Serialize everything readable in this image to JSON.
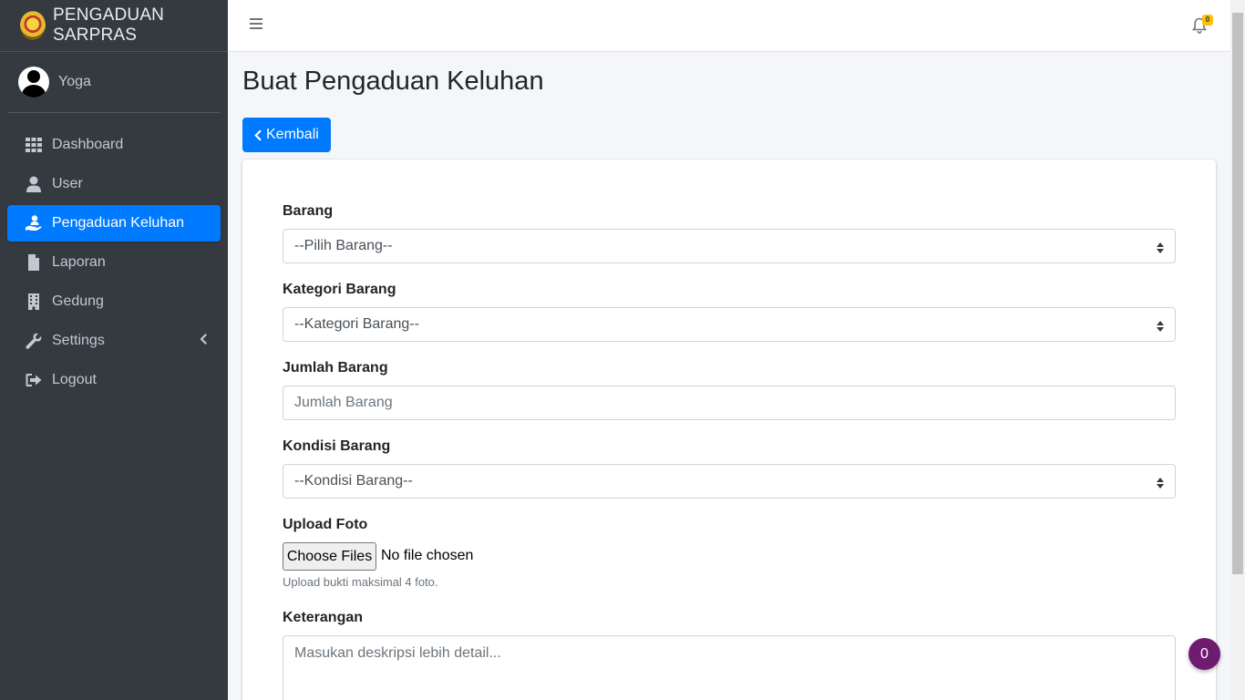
{
  "brand": {
    "title": "PENGADUAN SARPRAS"
  },
  "user": {
    "name": "Yoga"
  },
  "sidebar": {
    "items": [
      {
        "label": "Dashboard",
        "icon": "th-grid-icon"
      },
      {
        "label": "User",
        "icon": "user-icon"
      },
      {
        "label": "Pengaduan Keluhan",
        "icon": "hand-holding-user-icon",
        "active": true
      },
      {
        "label": "Laporan",
        "icon": "file-icon"
      },
      {
        "label": "Gedung",
        "icon": "building-icon"
      },
      {
        "label": "Settings",
        "icon": "wrench-icon",
        "has_submenu": true
      },
      {
        "label": "Logout",
        "icon": "sign-out-icon"
      }
    ]
  },
  "topbar": {
    "notification_count": "0"
  },
  "page": {
    "title": "Buat Pengaduan Keluhan",
    "back_label": "Kembali"
  },
  "form": {
    "barang": {
      "label": "Barang",
      "value": "--Pilih Barang--"
    },
    "kategori": {
      "label": "Kategori Barang",
      "value": "--Kategori Barang--"
    },
    "jumlah": {
      "label": "Jumlah Barang",
      "placeholder": "Jumlah Barang"
    },
    "kondisi": {
      "label": "Kondisi Barang",
      "value": "--Kondisi Barang--"
    },
    "foto": {
      "label": "Upload Foto",
      "button": "Choose Files",
      "status": "No file chosen",
      "help": "Upload bukti maksimal 4 foto."
    },
    "keterangan": {
      "label": "Keterangan",
      "placeholder": "Masukan deskripsi lebih detail..."
    }
  },
  "chat": {
    "count": "0"
  },
  "colors": {
    "sidebar_bg": "#343a40",
    "primary": "#007bff",
    "badge": "#ffc107",
    "chat_bubble": "#6f1b70"
  }
}
